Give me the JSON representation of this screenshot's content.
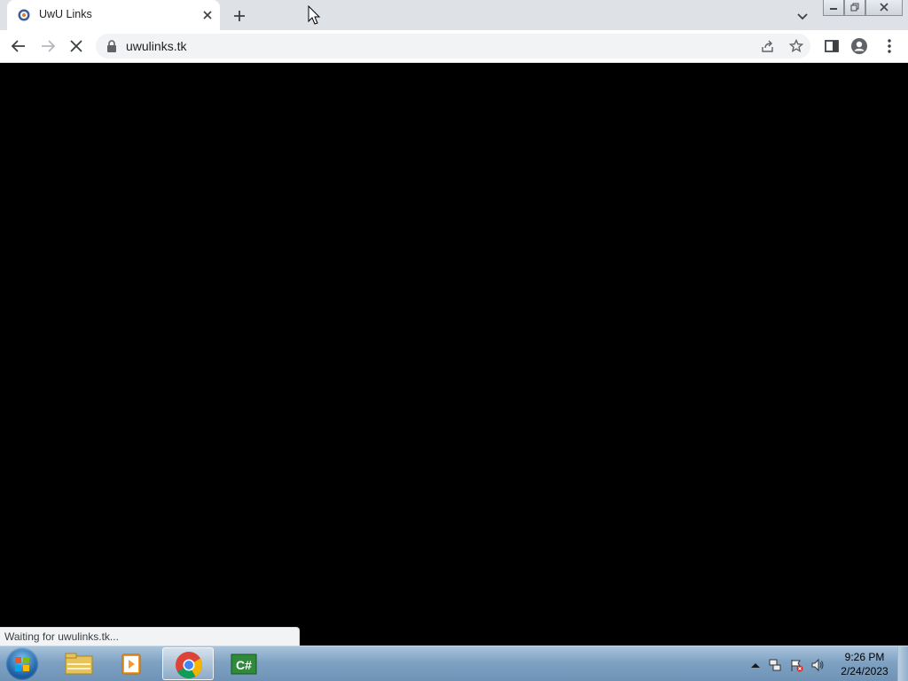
{
  "browser": {
    "tab": {
      "title": "UwU Links"
    },
    "address": {
      "url": "uwulinks.tk"
    },
    "status_text": "Waiting for uwulinks.tk...",
    "icons": [
      "favicon-icon",
      "close-icon",
      "plus-icon",
      "chevron-down-icon",
      "minimize-icon",
      "restore-icon",
      "close-window-icon",
      "back-arrow-icon",
      "forward-arrow-icon",
      "stop-loading-icon",
      "lock-icon",
      "share-icon",
      "star-icon",
      "side-panel-icon",
      "profile-icon",
      "more-vert-icon"
    ]
  },
  "taskbar": {
    "clock": {
      "time": "9:26 PM",
      "date": "2/24/2023"
    },
    "apps": [
      "start-orb-icon",
      "file-explorer-icon",
      "media-player-icon",
      "chrome-icon",
      "csharp-icon"
    ],
    "tray": [
      "tray-expand-icon",
      "network-icon",
      "action-center-icon",
      "volume-icon"
    ]
  },
  "colors": {
    "tab_strip": "#dee1e6",
    "toolbar": "#ffffff",
    "omnibox": "#f1f3f4",
    "content": "#000000",
    "taskbar": "#7fa2c3"
  }
}
